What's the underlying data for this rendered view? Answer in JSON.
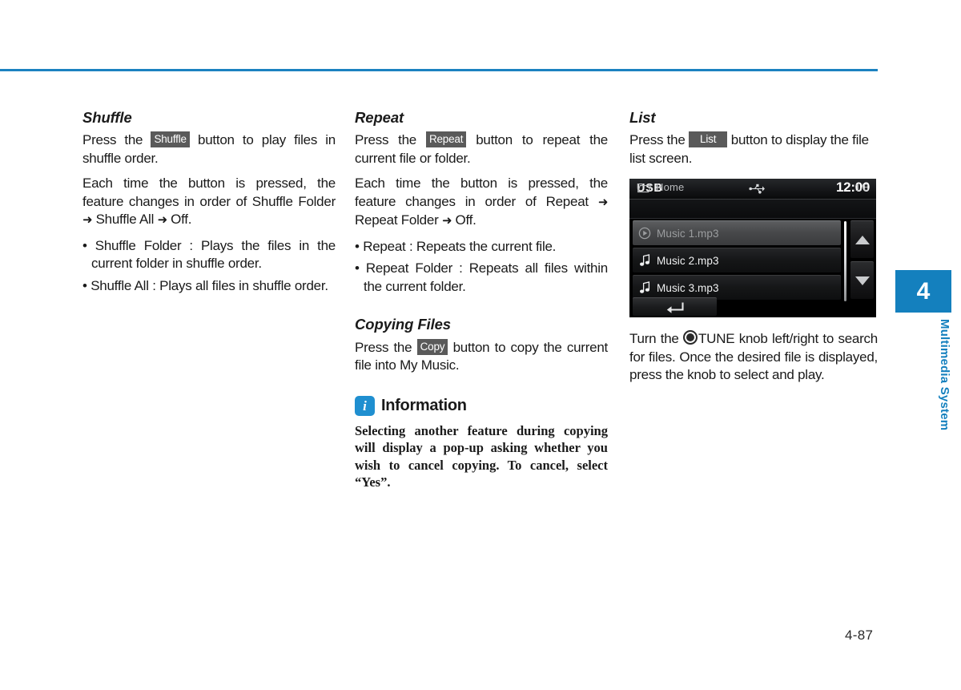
{
  "page": {
    "number": "4-87",
    "accent_color": "#1480be",
    "chip_color": "#5a5a5a"
  },
  "chapter_tab": {
    "number": "4",
    "label": "Multimedia System"
  },
  "columns": {
    "shuffle": {
      "heading": "Shuffle",
      "para1_pre": "Press the",
      "chip": "Shuffle",
      "para1_post": "button to play files in shuffle order.",
      "para2": "Each time the button is pressed, the feature changes in order of Shuffle Folder",
      "para2_mid": "Shuffle All",
      "para2_end": "Off.",
      "arrow": "➜",
      "bullets": [
        "Shuffle Folder : Plays the files in the current folder in shuffle order.",
        "Shuffle All : Plays all files in shuffle order."
      ],
      "bullet_mark": "•"
    },
    "repeat": {
      "heading": "Repeat",
      "para1_pre": "Press the",
      "chip": "Repeat",
      "para1_post": "button to repeat the current file or folder.",
      "para2": "Each time the button is pressed, the feature changes in order of Repeat",
      "para2_mid": "Repeat Folder",
      "para2_end": "Off.",
      "arrow": "➜",
      "bullets": [
        "Repeat : Repeats the current file.",
        "Repeat Folder : Repeats all files within the current folder."
      ],
      "bullet_mark": "•"
    },
    "copying": {
      "heading": "Copying Files",
      "para1_pre": "Press the",
      "chip": "Copy",
      "para1_post": "button to copy the current file into My Music."
    },
    "information": {
      "badge": "i",
      "title": "Information",
      "body": "Selecting another feature during copying will display a pop-up asking whether you wish to cancel copying. To cancel, select “Yes”."
    },
    "list": {
      "heading": "List",
      "para1_pre": "Press the",
      "chip": "List",
      "para1_post": "button to display the file list screen.",
      "tune_pre": "Turn the",
      "tune_label": "TUNE",
      "tune_post": "knob left/right to search for files. Once the desired file is displayed, press the knob to select and play."
    }
  },
  "usb_screen": {
    "source": "USB",
    "time": "12:00",
    "path_label": "Home",
    "page_indicator": "1/8",
    "rows": [
      {
        "label": "Music 1.mp3",
        "icon": "play-circle-icon",
        "selected": true
      },
      {
        "label": "Music 2.mp3",
        "icon": "music-note-icon",
        "selected": false
      },
      {
        "label": "Music 3.mp3",
        "icon": "music-note-icon",
        "selected": false
      }
    ]
  }
}
